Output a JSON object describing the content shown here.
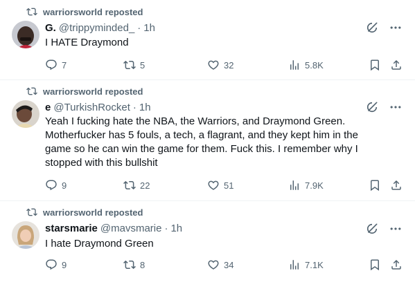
{
  "posts": [
    {
      "repost_text": "warriorsworld reposted",
      "name": "G.",
      "handle": "@trippyminded_",
      "separator": "·",
      "time": "1h",
      "text": "I HATE Draymond",
      "replies": "7",
      "reposts": "5",
      "likes": "32",
      "views": "5.8K"
    },
    {
      "repost_text": "warriorsworld reposted",
      "name": "e",
      "handle": "@TurkishRocket",
      "separator": "·",
      "time": "1h",
      "text": "Yeah I fucking hate the NBA, the Warriors, and Draymond Green. Motherfucker has 5 fouls, a tech, a flagrant, and they kept him in the game so he can win the game for them. Fuck this. I remember why I stopped with this bullshit",
      "replies": "9",
      "reposts": "22",
      "likes": "51",
      "views": "7.9K"
    },
    {
      "repost_text": "warriorsworld reposted",
      "name": "starsmarie",
      "handle": "@mavsmarie",
      "separator": "·",
      "time": "1h",
      "text": "I hate Draymond Green",
      "replies": "9",
      "reposts": "8",
      "likes": "34",
      "views": "7.1K"
    }
  ],
  "colors": {
    "text_primary": "#0f1419",
    "text_secondary": "#536471",
    "divider": "#eff3f4"
  },
  "icons": {
    "repost": "repost-icon",
    "grok": "grok-icon",
    "more": "more-icon",
    "reply": "reply-icon",
    "like": "like-icon",
    "views": "views-icon",
    "bookmark": "bookmark-icon",
    "share": "share-icon"
  }
}
